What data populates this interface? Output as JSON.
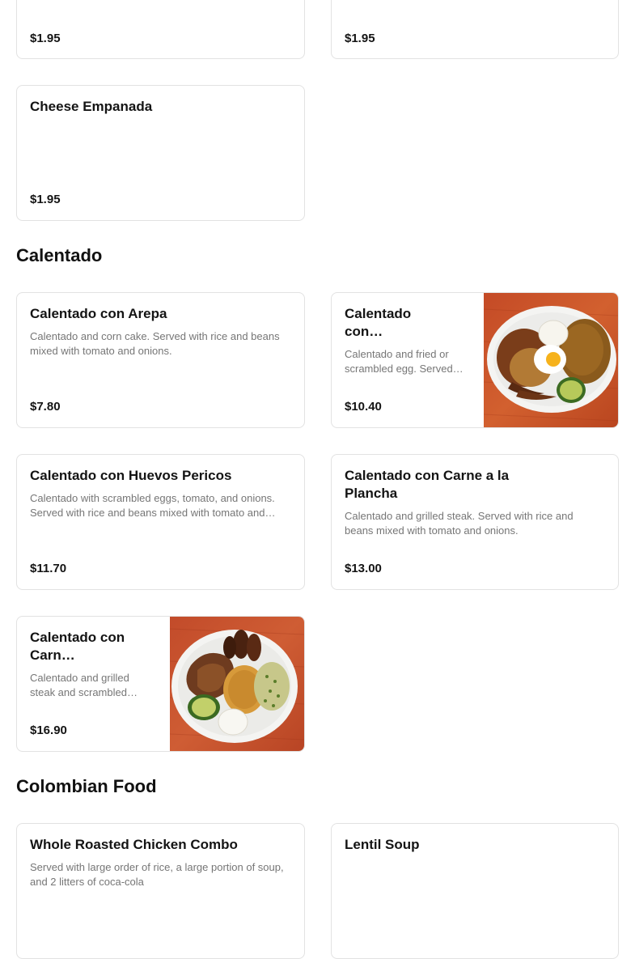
{
  "top_cards": [
    {
      "price": "$1.95"
    },
    {
      "price": "$1.95"
    }
  ],
  "cheese_card": {
    "title": "Cheese Empanada",
    "price": "$1.95"
  },
  "sections": {
    "calentado": {
      "title": "Calentado",
      "items": [
        {
          "title": "Calentado con Arepa",
          "description": "Calentado and corn cake. Served with rice and beans mixed with tomato and onions.",
          "price": "$7.80",
          "has_image": false
        },
        {
          "title": "Calentado con…",
          "description": "Calentado and fried or scrambled egg. Served…",
          "price": "$10.40",
          "has_image": true,
          "image_icon": "plate-rice-beans-egg-avocado-image"
        },
        {
          "title": "Calentado con Huevos Pericos",
          "description": "Calentado with scrambled eggs, tomato, and onions. Served with rice and beans mixed with tomato and…",
          "price": "$11.70",
          "has_image": false
        },
        {
          "title": "Calentado con Carne a la Plancha",
          "description": "Calentado and grilled steak. Served with rice and beans mixed with tomato and onions.",
          "price": "$13.00",
          "has_image": false
        },
        {
          "title": "Calentado con Carn…",
          "description": "Calentado and grilled steak and scrambled…",
          "price": "$16.90",
          "has_image": true,
          "image_icon": "plate-steak-rice-plantain-image"
        }
      ]
    },
    "colombian_food": {
      "title": "Colombian Food",
      "items": [
        {
          "title": "Whole Roasted Chicken Combo",
          "description": "Served with large order of rice, a large portion of soup, and 2 litters of coca-cola"
        },
        {
          "title": "Lentil Soup",
          "description": ""
        }
      ]
    }
  },
  "colors": {
    "card_border": "#e2e2e2",
    "title_text": "#141414",
    "description_text": "#767676",
    "image_background_wood": "#c8552e"
  }
}
